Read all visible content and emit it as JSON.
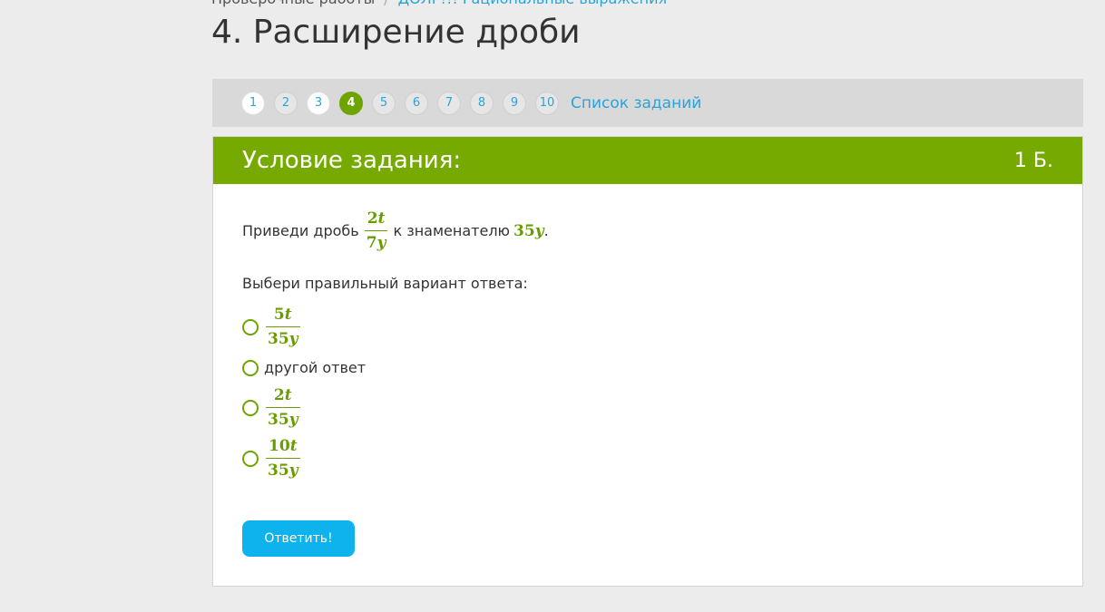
{
  "breadcrumb": {
    "items": [
      "Проверочные работы",
      "ДОЛГ!!! Рациональные выражения"
    ],
    "separator": "/"
  },
  "page_title": "4. Расширение дроби",
  "pager": {
    "pages": [
      "1",
      "2",
      "3",
      "4",
      "5",
      "6",
      "7",
      "8",
      "9",
      "10"
    ],
    "current": "4",
    "task_list_label": "Список заданий"
  },
  "card": {
    "header_title": "Условие задания:",
    "points": "1 Б."
  },
  "question": {
    "prefix": "Приведи дробь",
    "fraction_num_coef": "2",
    "fraction_num_var": "t",
    "fraction_den_coef": "7",
    "fraction_den_var": "y",
    "middle": "к знаменателю",
    "target_coef": "35",
    "target_var": "y",
    "end": "."
  },
  "prompt": "Выбери правильный вариант ответа:",
  "options": [
    {
      "type": "fraction",
      "num_coef": "5",
      "num_var": "t",
      "den_coef": "35",
      "den_var": "y"
    },
    {
      "type": "text",
      "text": "другой ответ"
    },
    {
      "type": "fraction",
      "num_coef": "2",
      "num_var": "t",
      "den_coef": "35",
      "den_var": "y"
    },
    {
      "type": "fraction",
      "num_coef": "10",
      "num_var": "t",
      "den_coef": "35",
      "den_var": "y"
    }
  ],
  "submit_label": "Ответить!",
  "colors": {
    "accent_green": "#76aa01",
    "link_blue": "#2aa4d8",
    "button_blue": "#0eb2ec"
  }
}
